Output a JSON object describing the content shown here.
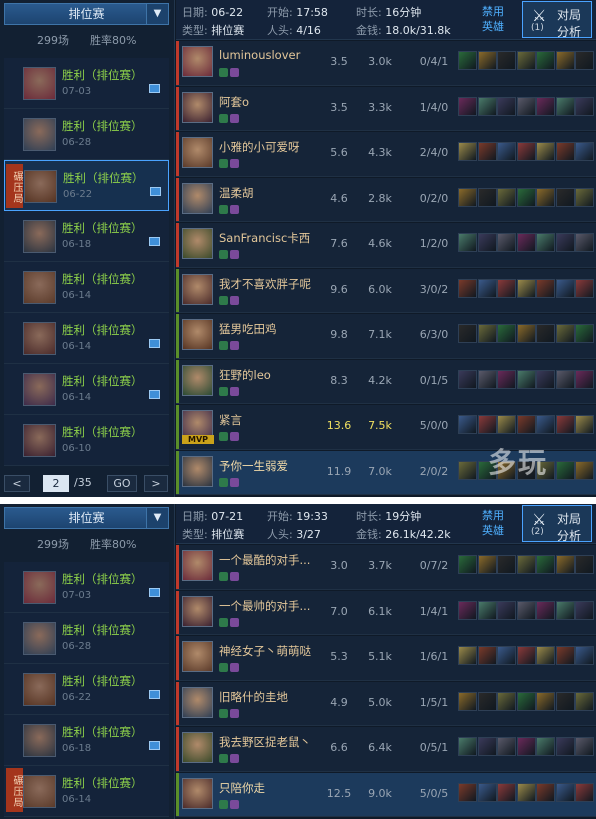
{
  "colors": {
    "win": "#8ed24a",
    "accent": "#4aa3ff",
    "name": "#e3c79a",
    "team_a": "#c0392b",
    "team_b": "#5a8f2a"
  },
  "p1": {
    "mode": "排位赛",
    "games": "299场",
    "winrate": "胜率80%",
    "matches": [
      {
        "result": "胜利（排位赛）",
        "date": "07-03"
      },
      {
        "result": "胜利（排位赛）",
        "date": "06-28"
      },
      {
        "result": "胜利（排位赛）",
        "date": "06-22"
      },
      {
        "result": "胜利（排位赛）",
        "date": "06-18"
      },
      {
        "result": "胜利（排位赛）",
        "date": "06-14"
      },
      {
        "result": "胜利（排位赛）",
        "date": "06-14"
      },
      {
        "result": "胜利（排位赛）",
        "date": "06-14"
      },
      {
        "result": "胜利（排位赛）",
        "date": "06-10"
      }
    ],
    "stomp_tag": "碾压局",
    "page": "2",
    "page_total": "/35",
    "go": "GO",
    "prev": "<",
    "next": ">",
    "header": {
      "date_label": "日期:",
      "date": "06-22",
      "start_label": "开始:",
      "start": "17:58",
      "dur_label": "时长:",
      "dur": "16分钟",
      "type_label": "类型:",
      "type": "排位赛",
      "kills_label": "人头:",
      "kills": "4/16",
      "gold_label": "金钱:",
      "gold": "18.0k/31.8k",
      "ban": "禁用\n英雄",
      "detail_x": "⚔",
      "detail_top": "对局",
      "detail_num": "(1)",
      "detail_bot": "分析"
    },
    "players": [
      {
        "name": "luminouslover",
        "score": "3.5",
        "gold": "3.0k",
        "kda": "0/4/1"
      },
      {
        "name": "阿套o",
        "score": "3.5",
        "gold": "3.3k",
        "kda": "1/4/0"
      },
      {
        "name": "小雅的小可爱呀",
        "score": "5.6",
        "gold": "4.3k",
        "kda": "2/4/0"
      },
      {
        "name": "温柔胡",
        "score": "4.6",
        "gold": "2.8k",
        "kda": "0/2/0"
      },
      {
        "name": "SanFrancisc卡西",
        "score": "7.6",
        "gold": "4.6k",
        "kda": "1/2/0"
      },
      {
        "name": "我才不喜欢胖子呢",
        "score": "9.6",
        "gold": "6.0k",
        "kda": "3/0/2"
      },
      {
        "name": "猛男吃田鸡",
        "score": "9.8",
        "gold": "7.1k",
        "kda": "6/3/0"
      },
      {
        "name": "狂野的leo",
        "score": "8.3",
        "gold": "4.2k",
        "kda": "0/1/5"
      },
      {
        "name": "紧言",
        "score": "13.6",
        "gold": "7.5k",
        "kda": "5/0/0",
        "mvp": "MVP"
      },
      {
        "name": "予你一生弱爱",
        "score": "11.9",
        "gold": "7.0k",
        "kda": "2/0/2"
      }
    ],
    "watermark": "多玩"
  },
  "p2": {
    "mode": "排位赛",
    "games": "299场",
    "winrate": "胜率80%",
    "matches": [
      {
        "result": "胜利（排位赛）",
        "date": "07-03"
      },
      {
        "result": "胜利（排位赛）",
        "date": "06-28"
      },
      {
        "result": "胜利（排位赛）",
        "date": "06-22"
      },
      {
        "result": "胜利（排位赛）",
        "date": "06-18"
      },
      {
        "result": "胜利（排位赛）",
        "date": "06-14"
      }
    ],
    "stomp_tag": "碾压局",
    "header": {
      "date_label": "日期:",
      "date": "07-21",
      "start_label": "开始:",
      "start": "19:33",
      "dur_label": "时长:",
      "dur": "19分钟",
      "type_label": "类型:",
      "type": "排位赛",
      "kills_label": "人头:",
      "kills": "3/27",
      "gold_label": "金钱:",
      "gold": "26.1k/42.2k",
      "ban": "禁用\n英雄",
      "detail_x": "⚔",
      "detail_top": "对局",
      "detail_num": "(2)",
      "detail_bot": "分析"
    },
    "players": [
      {
        "name": "一个最酷的对手...",
        "score": "3.0",
        "gold": "3.7k",
        "kda": "0/7/2"
      },
      {
        "name": "一个最帅的对手...",
        "score": "7.0",
        "gold": "6.1k",
        "kda": "1/4/1"
      },
      {
        "name": "神经女子丶萌萌哒",
        "score": "5.3",
        "gold": "5.1k",
        "kda": "1/6/1"
      },
      {
        "name": "旧略什的圭地",
        "score": "4.9",
        "gold": "5.0k",
        "kda": "1/5/1"
      },
      {
        "name": "我去野区捉老鼠丶",
        "score": "6.6",
        "gold": "6.4k",
        "kda": "0/5/1"
      },
      {
        "name": "只陪你走",
        "score": "12.5",
        "gold": "9.0k",
        "kda": "5/0/5"
      }
    ]
  }
}
